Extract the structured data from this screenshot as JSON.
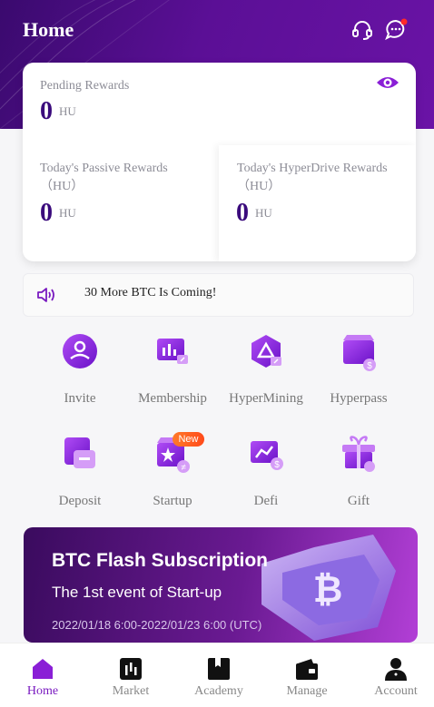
{
  "header": {
    "title": "Home",
    "support_icon": "headset-icon",
    "message_icon": "chat-bubble-icon"
  },
  "rewards": {
    "pending": {
      "label": "Pending Rewards",
      "value": "0",
      "unit": "HU"
    },
    "passive": {
      "label_line1": "Today's Passive Rewards",
      "label_line2": "（HU）",
      "value": "0",
      "unit": "HU"
    },
    "hyperdrive": {
      "label_line1": "Today's HyperDrive Rewards",
      "label_line2": "（HU）",
      "value": "0",
      "unit": "HU"
    }
  },
  "notice": {
    "text": "30 More BTC Is Coming!"
  },
  "menu": [
    {
      "label": "Invite",
      "icon": "invite-icon"
    },
    {
      "label": "Membership",
      "icon": "membership-icon"
    },
    {
      "label": "HyperMining",
      "icon": "hypermining-icon"
    },
    {
      "label": "Hyperpass",
      "icon": "hyperpass-icon"
    },
    {
      "label": "Deposit",
      "icon": "deposit-icon"
    },
    {
      "label": "Startup",
      "icon": "startup-icon",
      "badge": "New"
    },
    {
      "label": "Defi",
      "icon": "defi-icon"
    },
    {
      "label": "Gift",
      "icon": "gift-icon"
    }
  ],
  "banner": {
    "title": "BTC Flash Subscription",
    "subtitle": "The 1st event of Start-up",
    "dates": "2022/01/18 6:00-2022/01/23 6:00 (UTC)"
  },
  "tabs": [
    {
      "label": "Home",
      "active": true
    },
    {
      "label": "Market"
    },
    {
      "label": "Academy"
    },
    {
      "label": "Manage"
    },
    {
      "label": "Account"
    }
  ],
  "colors": {
    "accent": "#7a1bc0",
    "hero": "#5b0f96",
    "value": "#3a0a7c"
  }
}
